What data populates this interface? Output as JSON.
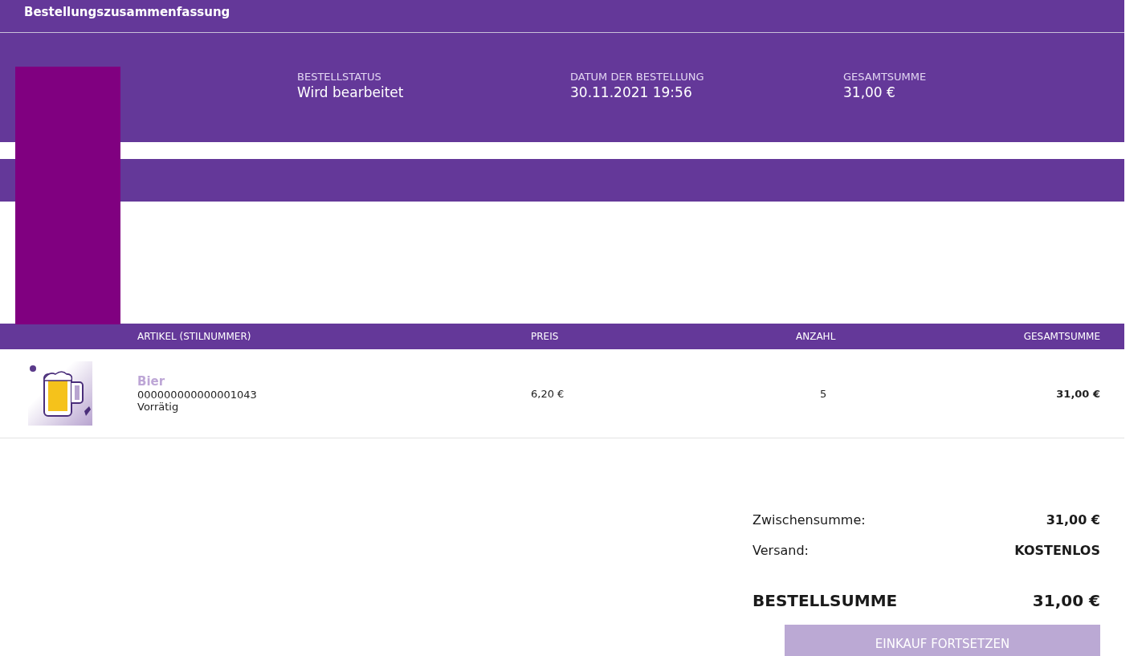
{
  "header": {
    "title": "Bestellungszusammenfassung"
  },
  "order_info": [
    {
      "label": "BESTELLSTATUS",
      "value": "Wird bearbeitet"
    },
    {
      "label": "DATUM DER BESTELLUNG",
      "value": "30.11.2021 19:56"
    },
    {
      "label": "GESAMTSUMME",
      "value": "31,00 €"
    }
  ],
  "table": {
    "columns": [
      "ARTIKEL (STILNUMMER)",
      "PREIS",
      "ANZAHL",
      "GESAMTSUMME"
    ],
    "rows": [
      {
        "name": "Bier",
        "style_number": "000000000000001043",
        "availability": "Vorrätig",
        "price": "6,20 €",
        "quantity": "5",
        "total": "31,00 €"
      }
    ]
  },
  "summary": {
    "lines": [
      {
        "label": "Zwischensumme:",
        "value": "31,00 €",
        "kind": "line"
      },
      {
        "label": "Versand:",
        "value": "KOSTENLOS",
        "kind": "line"
      },
      {
        "label": "BESTELLSUMME",
        "value": "31,00 €",
        "kind": "total"
      }
    ],
    "button": "EINKAUF FORTSETZEN"
  }
}
